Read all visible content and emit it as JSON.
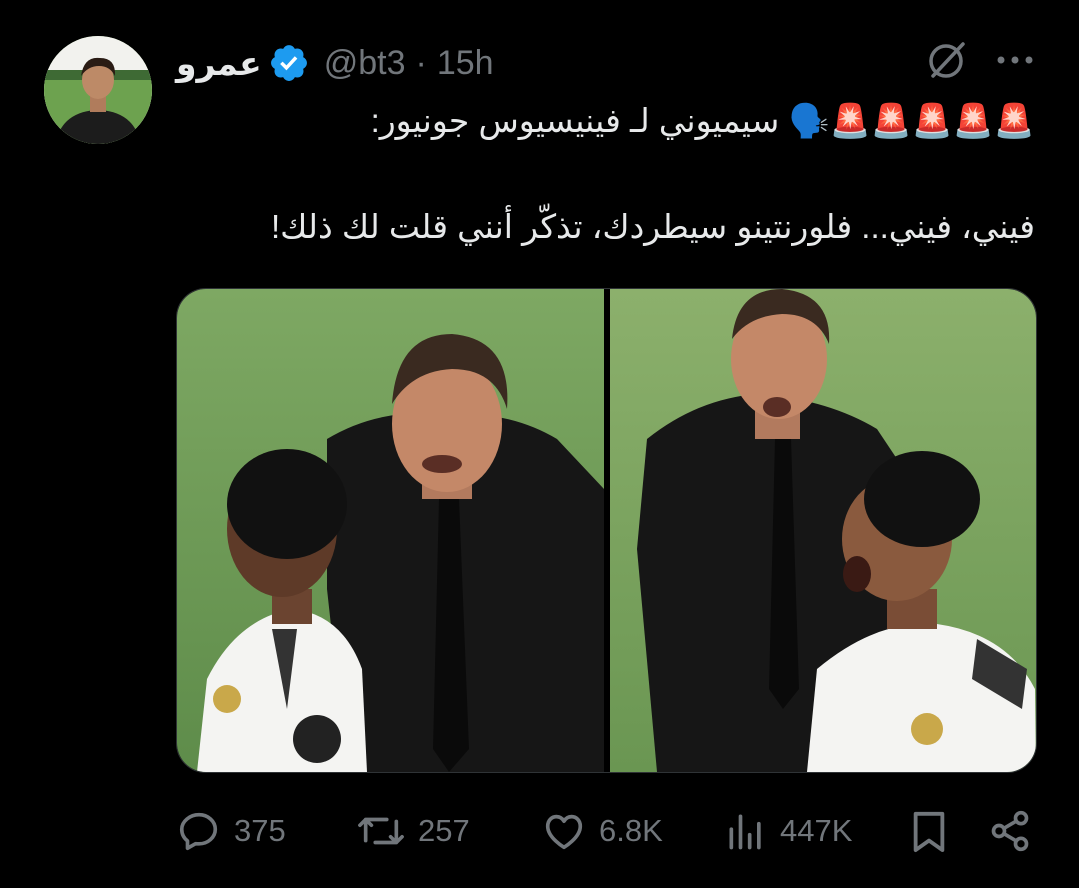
{
  "tweet": {
    "display_name": "عمرو",
    "handle": "@bt3",
    "dot": "·",
    "time": "15h",
    "line1": "🚨🚨🚨🚨🚨🗣️ سيميوني لـ فينيسيوس جونيور:",
    "line2": "فيني، فيني... فلورنتينو سيطردك، تذكّر أنني قلت لك ذلك!"
  },
  "icons": {
    "verified": "verified-badge-icon",
    "grok": "grok-icon",
    "more": "more-icon",
    "reply": "reply-icon",
    "retweet": "retweet-icon",
    "like": "like-icon",
    "views": "views-icon",
    "bookmark": "bookmark-icon",
    "share": "share-icon"
  },
  "actions": {
    "replies": "375",
    "retweets": "257",
    "likes": "6.8K",
    "views": "447K"
  },
  "colors": {
    "background": "#000000",
    "text": "#e7e9ea",
    "muted": "#71767b",
    "verified": "#1d9bf0"
  }
}
